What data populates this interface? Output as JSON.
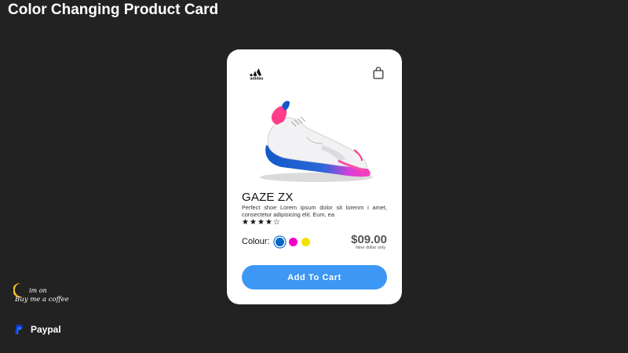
{
  "page": {
    "title": "Color Changing Product Card"
  },
  "card": {
    "brand": "adidas",
    "product_name": "GAZE ZX",
    "description": "Perfect shoe Lorem ipsum dolor sit lorenm i amet, consectetur adipisicing elit. Eum, ea",
    "rating": {
      "value": 4,
      "max": 5,
      "filled_icon": "★",
      "empty_icon": "☆"
    },
    "colour_label": "Colour:",
    "colours": [
      {
        "name": "blue",
        "hex": "#0067c6",
        "selected": true
      },
      {
        "name": "magenta",
        "hex": "#f500c8",
        "selected": false
      },
      {
        "name": "yellow",
        "hex": "#f2e300",
        "selected": false
      }
    ],
    "price": "$09.00",
    "price_caption": "Nine dollar only",
    "add_to_cart": "Add To Cart"
  },
  "footer": {
    "coffee_text": [
      "im on",
      "Buy me a coffee"
    ],
    "paypal": "Paypal"
  },
  "colors": {
    "background": "#222222",
    "card": "#ffffff",
    "button": "#3d97f5",
    "paypal_blue": "#003087"
  },
  "icons": [
    "adidas-logo",
    "shopping-bag-icon",
    "shoe-image",
    "star-icon",
    "coffee-moon-icon",
    "paypal-icon"
  ]
}
